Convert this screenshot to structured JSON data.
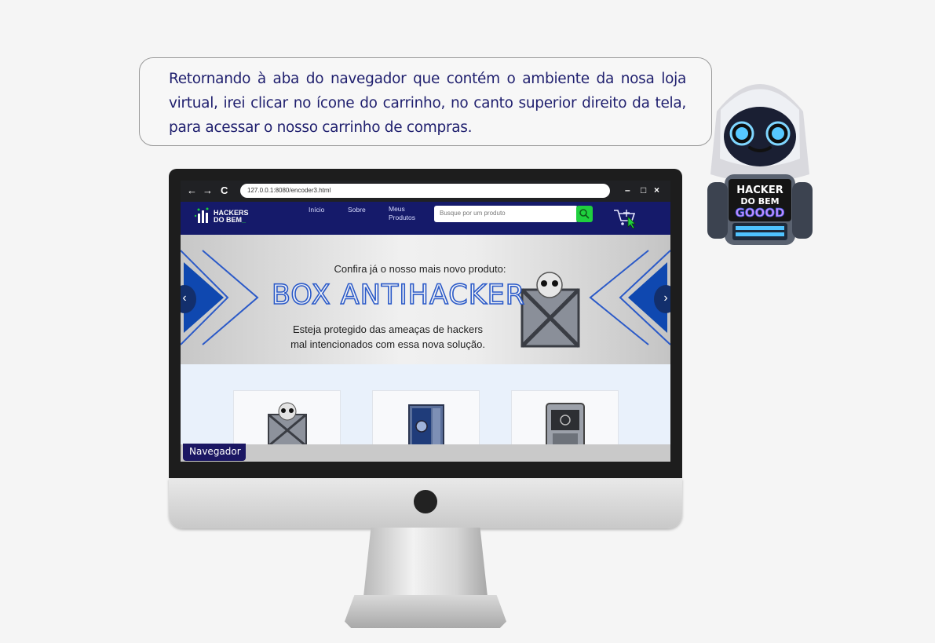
{
  "narration": {
    "text": "Retornando à aba do navegador que contém o ambiente da nosa loja virtual, irei clicar no ícone do carrinho, no canto superior direito da tela, para acessar o nosso carrinho de compras."
  },
  "mascot": {
    "badge_line1": "HACKER",
    "badge_line2": "DO BEM",
    "badge_line3": "GOOOD"
  },
  "browser": {
    "back": "←",
    "forward": "→",
    "reload": "C",
    "url": "127.0.0.1:8080/encoder3.html",
    "minimize": "–",
    "maximize": "□",
    "close": "×"
  },
  "site": {
    "logo_line1": "HACKERS",
    "logo_line2": "DO BEM",
    "logo_cursor": "_",
    "menu": {
      "inicio": "Início",
      "sobre": "Sobre",
      "meus": "Meus",
      "produtos": "Produtos"
    },
    "search_placeholder": "Busque por um produto"
  },
  "banner": {
    "top_text": "Confira já o nosso mais novo produto:",
    "title": "BOX ANTIHACKER",
    "sub_line1": "Esteja protegido das ameaças de hackers",
    "sub_line2": "mal intencionados com essa nova solução.",
    "prev": "‹",
    "next": "›"
  },
  "label": {
    "navegador": "Navegador"
  },
  "colors": {
    "header_bg": "#151a6a",
    "accent_green": "#1fd03e",
    "title_blue": "#2b5ac8"
  }
}
